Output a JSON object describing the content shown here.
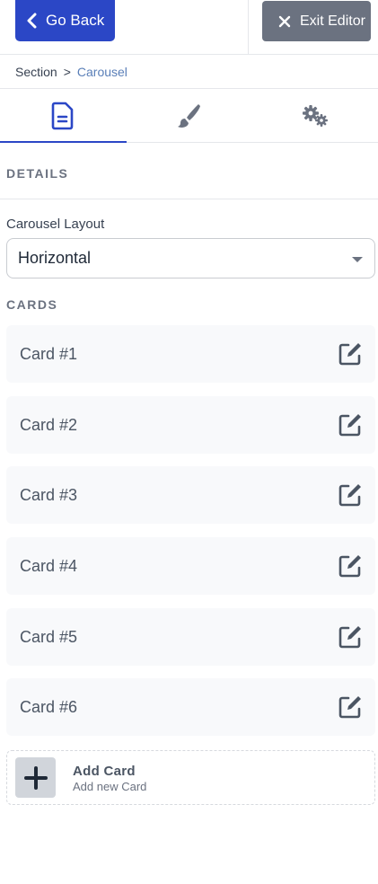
{
  "header": {
    "back_label": "Go Back",
    "exit_label": "Exit Editor"
  },
  "breadcrumb": {
    "root": "Section",
    "separator": ">",
    "current": "Carousel"
  },
  "tabs": [
    {
      "icon": "document-icon",
      "active": true
    },
    {
      "icon": "brush-icon",
      "active": false
    },
    {
      "icon": "gears-icon",
      "active": false
    }
  ],
  "details": {
    "heading": "DETAILS",
    "layout_label": "Carousel Layout",
    "layout_value": "Horizontal"
  },
  "cards": {
    "heading": "CARDS",
    "items": [
      "Card #1",
      "Card #2",
      "Card #3",
      "Card #4",
      "Card #5",
      "Card #6"
    ]
  },
  "add_card": {
    "title": "Add Card",
    "subtitle": "Add new Card"
  },
  "colors": {
    "primary": "#2b47c6",
    "secondary": "#6b7280",
    "link": "#5a7fb8"
  }
}
